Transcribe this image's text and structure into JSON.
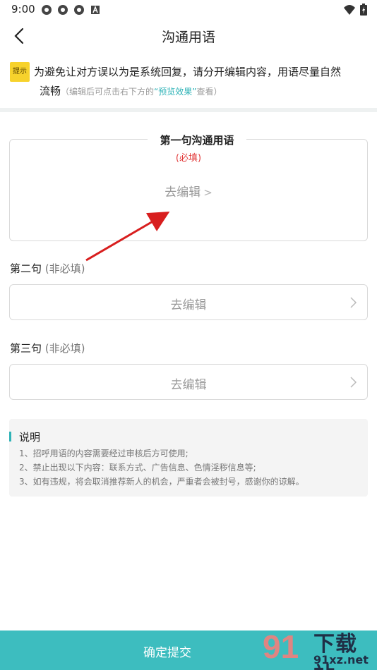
{
  "status_bar": {
    "time": "9:00",
    "app_icons": [
      "gear-icon",
      "gear-icon",
      "gear-icon",
      "a-icon"
    ],
    "right_icons": [
      "wifi-icon",
      "battery-icon"
    ]
  },
  "nav": {
    "title": "沟通用语",
    "back_icon": "chevron-left-icon"
  },
  "tip": {
    "badge": "提示",
    "line1": "为避免让对方误以为是系统回复，请分开编辑内容，用语尽量自然",
    "line2_main": "流畅",
    "hint_prefix": "（编辑后可点击右下方的",
    "hint_link": "“预览效果”",
    "hint_suffix": "查看）"
  },
  "sentence1": {
    "title": "第一句沟通用语",
    "required": "(必填)",
    "edit": "去编辑"
  },
  "sentence2": {
    "label": "第二句",
    "optional": "(非必填)",
    "edit": "去编辑"
  },
  "sentence3": {
    "label": "第三句",
    "optional": "(非必填)",
    "edit": "去编辑"
  },
  "note": {
    "title": "说明",
    "items": [
      "1、招呼用语的内容需要经过审核后方可使用;",
      "2、禁止出现以下内容：联系方式、广告信息、色情淫秽信息等;",
      "3、如有违规，将会取消推荐新人的机会，严重者会被封号，感谢你的谅解。"
    ]
  },
  "submit": {
    "label": "确定提交"
  },
  "watermark": {
    "number": "91",
    "big": "下载站",
    "site": "91xz.net"
  },
  "colors": {
    "accent": "#3dbdbf",
    "required": "#e23b3b",
    "badge": "#f7d22c",
    "arrow": "#d81e1e"
  }
}
